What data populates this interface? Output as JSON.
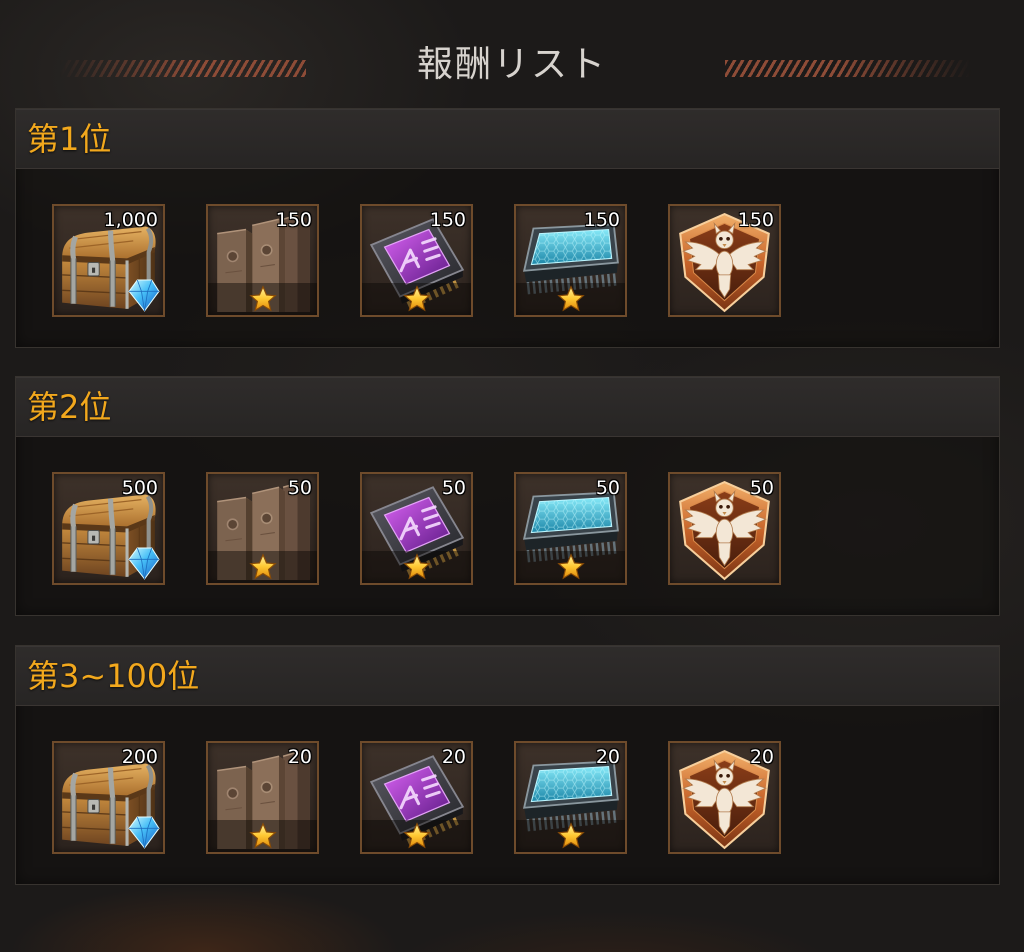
{
  "title": "報酬リスト",
  "colors": {
    "accent": "#f2a81d",
    "title": "#d7d3ce",
    "background": "#1c1a19",
    "item_border": "#6e4b2b"
  },
  "sections": [
    {
      "rank": "第1位",
      "items": [
        {
          "icon": "treasure-chest-icon",
          "count": "1,000"
        },
        {
          "icon": "wall-blocks-icon",
          "count": "150",
          "badge": "star-icon"
        },
        {
          "icon": "purple-chip-icon",
          "count": "150",
          "badge": "star-icon"
        },
        {
          "icon": "blue-chip-icon",
          "count": "150",
          "badge": "star-icon"
        },
        {
          "icon": "eagle-emblem-icon",
          "count": "150"
        }
      ]
    },
    {
      "rank": "第2位",
      "items": [
        {
          "icon": "treasure-chest-icon",
          "count": "500"
        },
        {
          "icon": "wall-blocks-icon",
          "count": "50",
          "badge": "star-icon"
        },
        {
          "icon": "purple-chip-icon",
          "count": "50",
          "badge": "star-icon"
        },
        {
          "icon": "blue-chip-icon",
          "count": "50",
          "badge": "star-icon"
        },
        {
          "icon": "eagle-emblem-icon",
          "count": "50"
        }
      ]
    },
    {
      "rank": "第3~100位",
      "items": [
        {
          "icon": "treasure-chest-icon",
          "count": "200"
        },
        {
          "icon": "wall-blocks-icon",
          "count": "20",
          "badge": "star-icon"
        },
        {
          "icon": "purple-chip-icon",
          "count": "20",
          "badge": "star-icon"
        },
        {
          "icon": "blue-chip-icon",
          "count": "20",
          "badge": "star-icon"
        },
        {
          "icon": "eagle-emblem-icon",
          "count": "20"
        }
      ]
    }
  ]
}
